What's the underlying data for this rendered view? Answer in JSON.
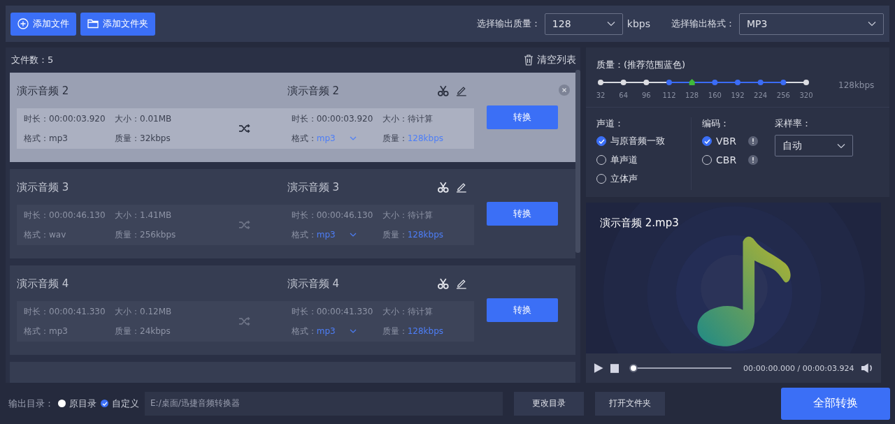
{
  "toolbar": {
    "add_file": "添加文件",
    "add_folder": "添加文件夹",
    "quality_label": "选择输出质量：",
    "quality_value": "128",
    "quality_unit": "kbps",
    "format_label": "选择输出格式：",
    "format_value": "MP3"
  },
  "file_list": {
    "count_label": "文件数：5",
    "clear": "清空列表",
    "files": [
      {
        "name": "演示音频 2",
        "selected": true,
        "duration": "时长：00:00:03.920",
        "size": "大小：0.01MB",
        "format": "格式：mp3",
        "quality": "质量：32kbps",
        "out_name": "演示音频 2",
        "out_duration": "时长：00:00:03.920",
        "out_size": "大小：待计算",
        "out_format_label": "格式：",
        "out_format": "mp3",
        "out_quality_label": "质量：",
        "out_quality": "128kbps",
        "convert": "转换"
      },
      {
        "name": "演示音频 3",
        "selected": false,
        "duration": "时长：00:00:46.130",
        "size": "大小：1.41MB",
        "format": "格式：wav",
        "quality": "质量：256kbps",
        "out_name": "演示音频 3",
        "out_duration": "时长：00:00:46.130",
        "out_size": "大小：待计算",
        "out_format_label": "格式：",
        "out_format": "mp3",
        "out_quality_label": "质量：",
        "out_quality": "128kbps",
        "convert": "转换"
      },
      {
        "name": "演示音频 4",
        "selected": false,
        "duration": "时长：00:00:41.330",
        "size": "大小：0.12MB",
        "format": "格式：mp3",
        "quality": "质量：24kbps",
        "out_name": "演示音频 4",
        "out_duration": "时长：00:00:41.330",
        "out_size": "大小：待计算",
        "out_format_label": "格式：",
        "out_format": "mp3",
        "out_quality_label": "质量：",
        "out_quality": "128kbps",
        "convert": "转换"
      }
    ]
  },
  "settings": {
    "quality_title": "质量：(推荐范围蓝色)",
    "quality_reading": "128kbps",
    "quality_points": [
      {
        "label": "32",
        "recommended": false,
        "selected": false
      },
      {
        "label": "64",
        "recommended": false,
        "selected": false
      },
      {
        "label": "96",
        "recommended": false,
        "selected": false
      },
      {
        "label": "112",
        "recommended": true,
        "selected": false
      },
      {
        "label": "128",
        "recommended": true,
        "selected": true
      },
      {
        "label": "160",
        "recommended": true,
        "selected": false
      },
      {
        "label": "192",
        "recommended": true,
        "selected": false
      },
      {
        "label": "224",
        "recommended": true,
        "selected": false
      },
      {
        "label": "256",
        "recommended": true,
        "selected": false
      },
      {
        "label": "320",
        "recommended": false,
        "selected": false
      }
    ],
    "channel_title": "声道：",
    "channels": [
      {
        "label": "与原音频一致",
        "selected": true
      },
      {
        "label": "单声道",
        "selected": false
      },
      {
        "label": "立体声",
        "selected": false
      }
    ],
    "encoding_title": "编码：",
    "encodings": [
      {
        "label": "VBR",
        "selected": true
      },
      {
        "label": "CBR",
        "selected": false
      }
    ],
    "sample_rate_title": "采样率：",
    "sample_rate_value": "自动"
  },
  "player": {
    "title": "演示音频 2.mp3",
    "level": 0,
    "time": "00:00:00.000 / 00:00:03.924"
  },
  "output": {
    "label": "输出目录：",
    "options": [
      {
        "label": "原目录",
        "selected": false
      },
      {
        "label": "自定义",
        "selected": true
      }
    ],
    "path": "E:/桌面/迅捷音频转换器",
    "change_dir": "更改目录",
    "open_folder": "打开文件夹",
    "convert_all": "全部转换"
  }
}
